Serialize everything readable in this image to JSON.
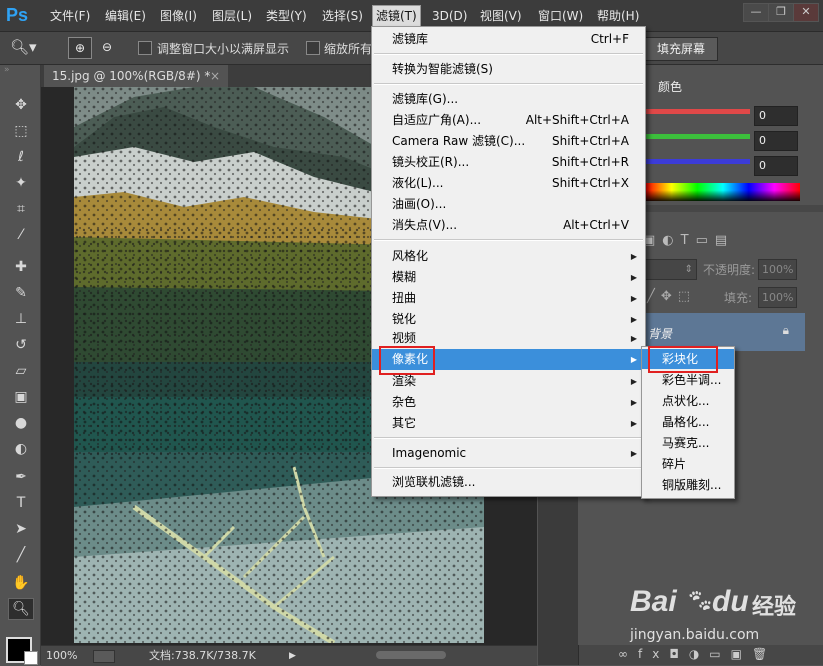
{
  "app": {
    "logo": "Ps"
  },
  "menubar": {
    "items": [
      "文件(F)",
      "编辑(E)",
      "图像(I)",
      "图层(L)",
      "类型(Y)",
      "选择(S)",
      "滤镜(T)",
      "3D(D)",
      "视图(V)",
      "窗口(W)",
      "帮助(H)"
    ],
    "active": "滤镜(T)"
  },
  "options": {
    "resize_window_label": "调整窗口大小以满屏显示",
    "zoom_all_label": "缩放所有",
    "fill_screen_label": "填充屏幕"
  },
  "document": {
    "tab_title": "15.jpg @ 100%(RGB/8#) *",
    "close_glyph": "×",
    "zoom": "100%",
    "doc_info": "文档:738.7K/738.7K"
  },
  "color_panel": {
    "tab_label": "颜色",
    "r": "0",
    "g": "0",
    "b": "0",
    "slider_colors": [
      "#e04848",
      "#3cbf3c",
      "#3c3cd8"
    ]
  },
  "layers_panel": {
    "opacity_label": "不透明度:",
    "opacity_value": "100%",
    "fill_label": "填充:",
    "fill_value": "100%",
    "background_layer": "背景"
  },
  "filter_menu": {
    "groups": [
      [
        {
          "label": "滤镜库",
          "shortcut": "Ctrl+F"
        }
      ],
      [
        {
          "label": "转换为智能滤镜(S)"
        }
      ],
      [
        {
          "label": "滤镜库(G)..."
        },
        {
          "label": "自适应广角(A)...",
          "shortcut": "Alt+Shift+Ctrl+A"
        },
        {
          "label": "Camera Raw 滤镜(C)...",
          "shortcut": "Shift+Ctrl+A"
        },
        {
          "label": "镜头校正(R)...",
          "shortcut": "Shift+Ctrl+R"
        },
        {
          "label": "液化(L)...",
          "shortcut": "Shift+Ctrl+X"
        },
        {
          "label": "油画(O)..."
        },
        {
          "label": "消失点(V)...",
          "shortcut": "Alt+Ctrl+V"
        }
      ],
      [
        {
          "label": "风格化",
          "submenu": true
        },
        {
          "label": "模糊",
          "submenu": true
        },
        {
          "label": "扭曲",
          "submenu": true
        },
        {
          "label": "锐化",
          "submenu": true
        },
        {
          "label": "视频",
          "submenu": true
        },
        {
          "label": "像素化",
          "submenu": true,
          "highlighted": true
        },
        {
          "label": "渲染",
          "submenu": true
        },
        {
          "label": "杂色",
          "submenu": true
        },
        {
          "label": "其它",
          "submenu": true
        }
      ],
      [
        {
          "label": "Imagenomic",
          "submenu": true
        }
      ],
      [
        {
          "label": "浏览联机滤镜..."
        }
      ]
    ]
  },
  "pixelate_submenu": {
    "items": [
      "彩块化",
      "彩色半调...",
      "点状化...",
      "晶格化...",
      "马赛克...",
      "碎片",
      "铜版雕刻..."
    ],
    "highlighted": "彩块化"
  },
  "watermark": {
    "brand_left": "Bai",
    "brand_right": "du",
    "brand_cn": "经验",
    "url": "jingyan.baidu.com"
  },
  "icons": [
    "move-icon",
    "marquee-icon",
    "lasso-icon",
    "magic-wand-icon",
    "crop-icon",
    "eyedropper-icon",
    "healing-icon",
    "brush-icon",
    "stamp-icon",
    "history-brush-icon",
    "eraser-icon",
    "gradient-icon",
    "blur-icon",
    "dodge-icon",
    "pen-icon",
    "type-icon",
    "path-select-icon",
    "line-icon",
    "hand-icon",
    "zoom-icon"
  ]
}
